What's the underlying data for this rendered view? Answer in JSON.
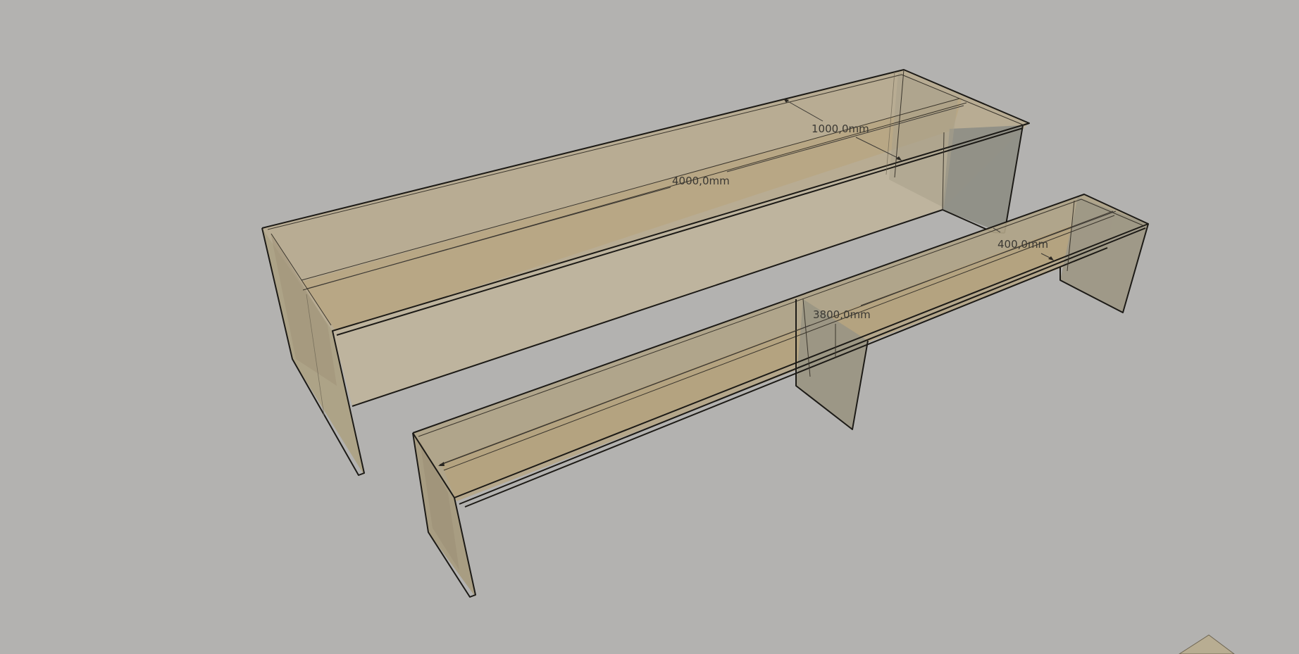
{
  "dimensions": {
    "table_width": "1000,0mm",
    "table_length": "4000,0mm",
    "bench_width": "400,0mm",
    "bench_length": "3800,0mm"
  },
  "colors": {
    "background": "#b3b2b0",
    "wood_top": "#b9ab90",
    "wood_inner": "#b8a886",
    "wood_side": "#a89c80",
    "leg_shadow": "#8e8d82",
    "edge": "#1c1a16"
  },
  "icons": {
    "axis_gizmo": "axes-icon"
  }
}
